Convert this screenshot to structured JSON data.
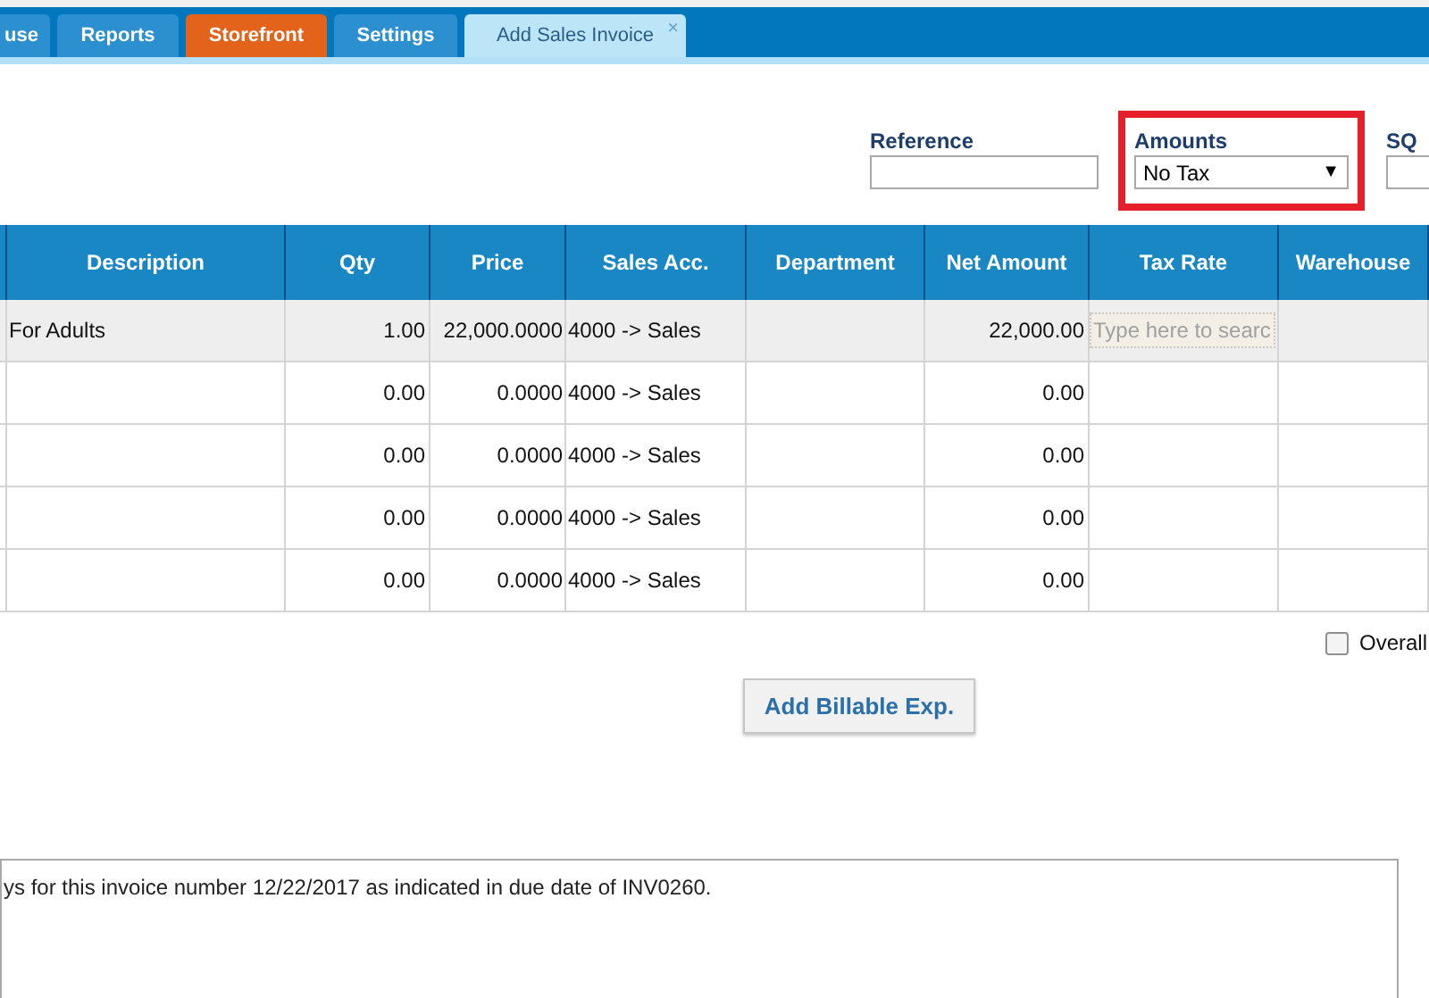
{
  "tabs": [
    {
      "label": "use",
      "kind": "normal",
      "selected": false
    },
    {
      "label": "Reports",
      "kind": "normal",
      "selected": false
    },
    {
      "label": "Storefront",
      "kind": "highlight",
      "selected": false
    },
    {
      "label": "Settings",
      "kind": "normal",
      "selected": false
    },
    {
      "label": "Add Sales Invoice",
      "kind": "normal",
      "selected": true,
      "close": "×"
    }
  ],
  "fields": [
    {
      "label": "Reference",
      "kind": "text",
      "highlighted": false
    },
    {
      "label": "Amounts",
      "kind": "select",
      "value": "No Tax",
      "caret": "▼",
      "highlighted": true
    },
    {
      "label": "SQ",
      "kind": "text",
      "highlighted": false
    }
  ],
  "table": {
    "columns": [
      "",
      "Description",
      "Qty",
      "Price",
      "Sales Acc.",
      "Department",
      "Net Amount",
      "Tax Rate",
      "Warehouse"
    ],
    "rows": [
      {
        "selected": true,
        "cells": [
          "",
          "For Adults",
          "1.00",
          "22,000.0000",
          "4000 -> Sales",
          "",
          "22,000.00",
          "",
          ""
        ],
        "tax_rate_placeholder": "Type here to searc"
      },
      {
        "selected": false,
        "cells": [
          "",
          "",
          "0.00",
          "0.0000",
          "4000 -> Sales",
          "",
          "0.00",
          "",
          ""
        ]
      },
      {
        "selected": false,
        "cells": [
          "",
          "",
          "0.00",
          "0.0000",
          "4000 -> Sales",
          "",
          "0.00",
          "",
          ""
        ]
      },
      {
        "selected": false,
        "cells": [
          "",
          "",
          "0.00",
          "0.0000",
          "4000 -> Sales",
          "",
          "0.00",
          "",
          ""
        ]
      },
      {
        "selected": false,
        "cells": [
          "",
          "",
          "0.00",
          "0.0000",
          "4000 -> Sales",
          "",
          "0.00",
          "",
          ""
        ]
      }
    ]
  },
  "overall": {
    "label": "Overall",
    "checked": false
  },
  "add_billable_button": "Add Billable Exp.",
  "notes": "ys for this invoice number 12/22/2017 as indicated in due date of INV0260."
}
